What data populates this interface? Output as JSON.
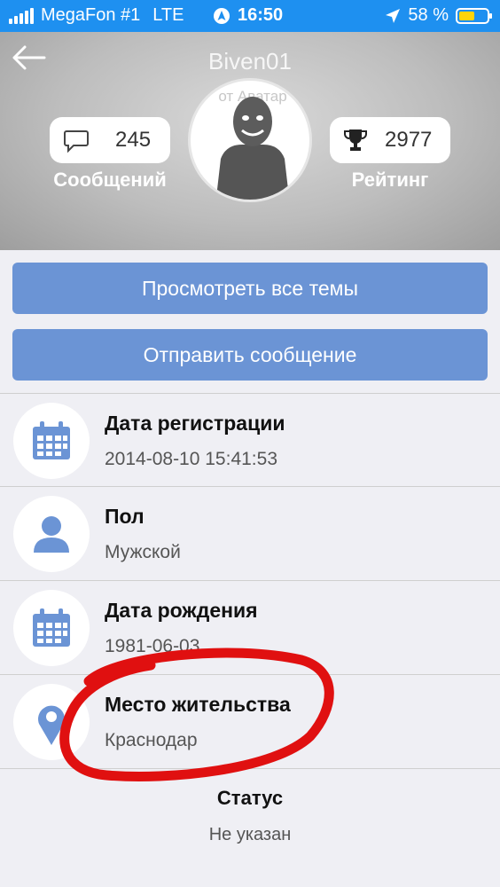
{
  "status_bar": {
    "carrier": "MegaFon #1",
    "network": "LTE",
    "time": "16:50",
    "battery_text": "58 %",
    "battery_level": 0.58,
    "battery_color": "#ffd40a"
  },
  "profile": {
    "username": "Biven01",
    "avatar_alt": "от Аватар",
    "messages_count": "245",
    "messages_label": "Сообщений",
    "rating_count": "2977",
    "rating_label": "Рейтинг"
  },
  "actions": {
    "view_topics": "Просмотреть все темы",
    "send_message": "Отправить сообщение"
  },
  "info": [
    {
      "icon": "calendar-icon",
      "label": "Дата регистрации",
      "value": "2014-08-10 15:41:53"
    },
    {
      "icon": "person-icon",
      "label": "Пол",
      "value": "Мужской"
    },
    {
      "icon": "calendar-icon",
      "label": "Дата рождения",
      "value": "1981-06-03"
    },
    {
      "icon": "location-pin-icon",
      "label": "Место жительства",
      "value": "Краснодар"
    }
  ],
  "status": {
    "label": "Статус",
    "value": "Не указан"
  },
  "colors": {
    "accent": "#6b94d5",
    "status_bar": "#1e90f0",
    "annotation": "#e01010"
  }
}
